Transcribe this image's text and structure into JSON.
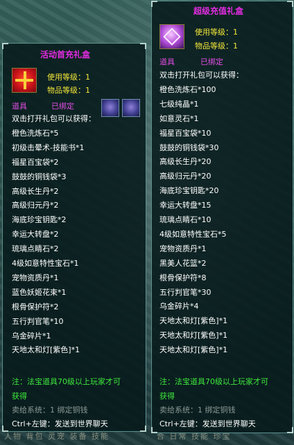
{
  "background": {
    "tabs_left": [
      "人物",
      "背包",
      "灵宠",
      "装备",
      "技能"
    ],
    "tabs_right": [
      "合",
      "日常",
      "技能",
      "珍宝"
    ]
  },
  "tooltip_left": {
    "title": "活动首充礼盒",
    "icon": "gift-box-icon-red",
    "use_level_label": "使用等级：1",
    "item_level_label": "物品等级：1",
    "category": "道具",
    "bound": "已绑定",
    "lines": [
      "双击打开礼包可以获得：",
      "橙色洗炼石*5",
      "初级击晕术-技能书*1",
      "福星百宝袋*2",
      "鼓鼓的铜钱袋*3",
      "高级长生丹*2",
      "高级归元丹*2",
      "海底珍宝钥匙*2",
      "幸运大转盘*2",
      "琉璃点睛石*2",
      "4级如意特性宝石*1",
      "宠物资质丹*1",
      "蓝色妖姬花束*1",
      "根骨保护符*2",
      "五行判官笔*10",
      "乌金碎片*1",
      "天地太和灯[紫色]*1"
    ],
    "note_line1": "注：法宝道具70级以上玩家才可",
    "note_line2": "获得",
    "sell_info": "卖给系统：1 绑定铜钱",
    "ctrl_tip": "Ctrl+左键：发送到世界聊天"
  },
  "tooltip_right": {
    "title": "超级充值礼盒",
    "icon": "gift-box-icon-purple",
    "use_level_label": "使用等级：1",
    "item_level_label": "物品等级：1",
    "category": "道具",
    "bound": "已绑定",
    "lines": [
      "双击打开礼包可以获得：",
      "橙色洗炼石*100",
      "七级纯晶*1",
      "如意灵石*1",
      "福星百宝袋*10",
      "鼓鼓的铜钱袋*30",
      "高级长生丹*20",
      "高级归元丹*20",
      "海底珍宝钥匙*20",
      "幸运大转盘*15",
      "琉璃点睛石*10",
      "4级如意特性宝石*5",
      "宠物资质丹*1",
      "黑美人花篮*2",
      "根骨保护符*8",
      "五行判官笔*30",
      "乌金碎片*4",
      "天地太和灯[紫色]*1",
      "天地太和灯[紫色]*1",
      "天地太和灯[紫色]*1"
    ],
    "note_line1": "注：法宝道具70级以上玩家才可",
    "note_line2": "获得",
    "sell_info": "卖给系统：1 绑定铜钱",
    "ctrl_tip": "Ctrl+左键：发送到世界聊天"
  }
}
